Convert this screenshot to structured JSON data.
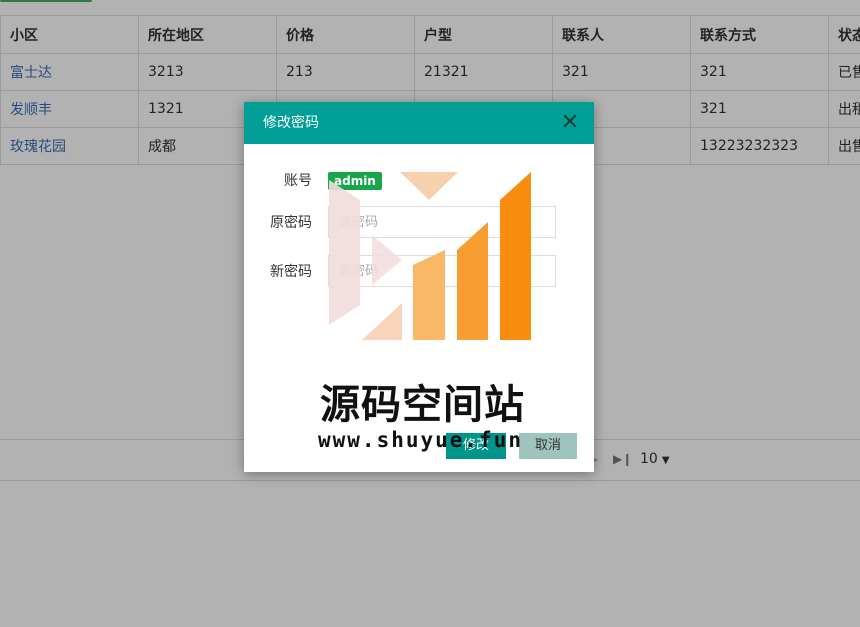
{
  "table": {
    "columns": [
      "小区",
      "所在地区",
      "价格",
      "户型",
      "联系人",
      "联系方式",
      "状态"
    ],
    "rows": [
      [
        "富士达",
        "3213",
        "213",
        "21321",
        "321",
        "321",
        "已售"
      ],
      [
        "发顺丰",
        "1321",
        "",
        "",
        "",
        "321",
        "出租"
      ],
      [
        "玫瑰花园",
        "成都",
        "",
        "",
        "",
        "13223232323",
        "出售"
      ]
    ]
  },
  "pager": {
    "page_size": "10"
  },
  "modal": {
    "title": "修改密码",
    "account_label": "账号",
    "account_value": "admin",
    "old_password_label": "原密码",
    "old_password_placeholder": "原密码",
    "new_password_label": "新密码",
    "new_password_placeholder": "新密码",
    "submit_label": "修改",
    "cancel_label": "取消"
  },
  "watermark": {
    "title": "源码空间站",
    "url": "www.shuyue.fun"
  },
  "colors": {
    "modal_header": "#009e94",
    "primary_button": "#00958b",
    "badge": "#19a64b",
    "link": "#3a6fb2"
  }
}
